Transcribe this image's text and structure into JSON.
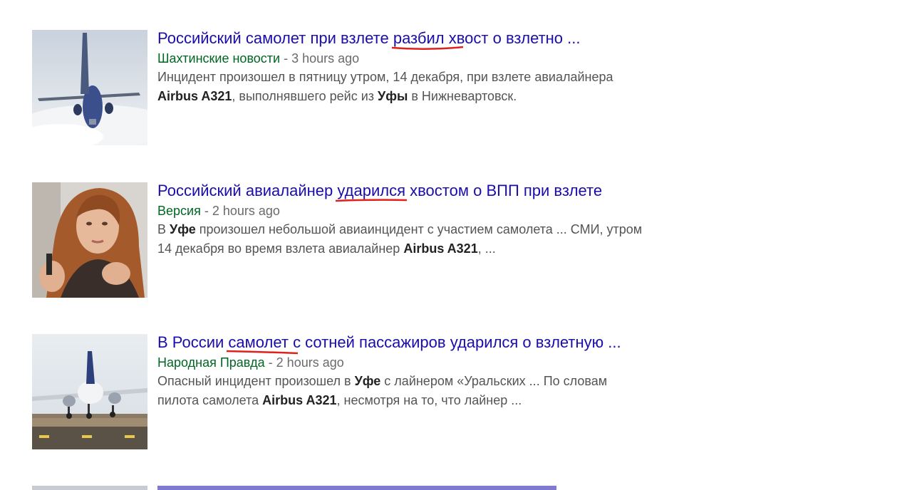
{
  "results": [
    {
      "title_before": "Российский самолет при взлете ",
      "title_highlight": "разбил хвост о",
      "title_after": " взлетно ...",
      "source": "Шахтинские новости",
      "separator": " - ",
      "time": "3 hours ago",
      "snippet_line1": "Инцидент произошел в пятницу утром, 14 декабря, при взлете авиалайнера",
      "snippet_l2_bold1": "Airbus A321",
      "snippet_l2_text1": ", выполнявшего рейс из ",
      "snippet_l2_bold2": "Уфы",
      "snippet_l2_text2": " в Нижневартовск."
    },
    {
      "title_before": "Российский авиалайнер ",
      "title_highlight": "ударился хвостом о",
      "title_after": " ВПП при взлете",
      "source": "Версия",
      "separator": " - ",
      "time": "2 hours ago",
      "snippet_l1_text1": "В ",
      "snippet_l1_bold1": "Уфе",
      "snippet_l1_text2": " произошел небольшой авиаинцидент с участием самолета ... СМИ, утром",
      "snippet_l2_text1": "14 декабря во время взлета авиалайнер ",
      "snippet_l2_bold1": "Airbus A321",
      "snippet_l2_text2": ", ..."
    },
    {
      "title_before": "В России ",
      "title_highlight": "самолет с сотней пассажиров ударился о",
      "title_after": " взлетную ...",
      "source": "Народная Правда",
      "separator": " - ",
      "time": "2 hours ago",
      "snippet_l1_text1": "Опасный инцидент произошел в ",
      "snippet_l1_bold1": "Уфе",
      "snippet_l1_text2": " с лайнером «Уральских ... По словам",
      "snippet_l2_text1": "пилота самолета ",
      "snippet_l2_bold1": "Airbus A321",
      "snippet_l2_text2": ", несмотря на то, что лайнер ..."
    }
  ],
  "colors": {
    "title_link": "#1a0dab",
    "source": "#006621",
    "meta": "#6a6a6a",
    "snippet": "#545454",
    "annotation": "#e0201b"
  },
  "icons": [
    "plane-takeoff-photo",
    "woman-portrait-photo",
    "plane-landing-photo",
    "generic-news-photo"
  ]
}
